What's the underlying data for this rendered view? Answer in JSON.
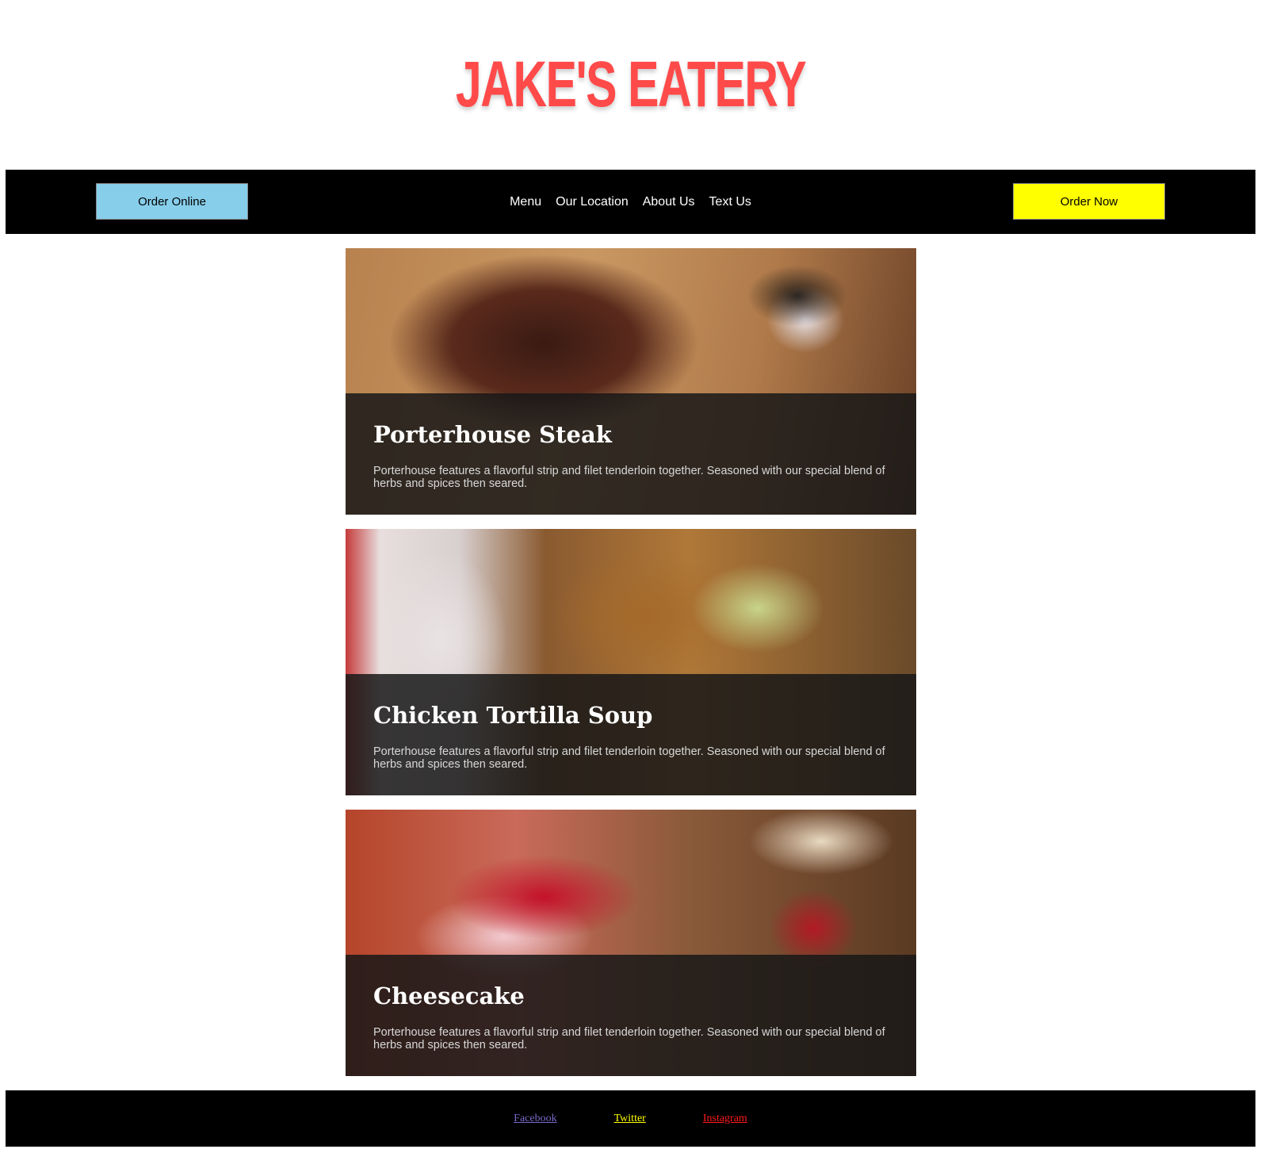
{
  "brand": {
    "logo_text": "Jake's Eatery",
    "logo_color": "#ff4a4a"
  },
  "nav": {
    "order_online_label": "Order Online",
    "order_online_color": "#87ceeb",
    "links": [
      "Menu",
      "Our Location",
      "About Us",
      "Text Us"
    ],
    "order_now_label": "Order Now",
    "order_now_color": "#ffff00"
  },
  "menu_items": [
    {
      "title": "Porterhouse Steak",
      "description": "Porterhouse features a flavorful strip and filet tenderloin together. Seasoned with our special blend of herbs and spices then seared.",
      "image": "steak-photo"
    },
    {
      "title": "Chicken Tortilla Soup",
      "description": "Porterhouse features a flavorful strip and filet tenderloin together. Seasoned with our special blend of herbs and spices then seared.",
      "image": "soup-photo"
    },
    {
      "title": "Cheesecake",
      "description": "Porterhouse features a flavorful strip and filet tenderloin together. Seasoned with our special blend of herbs and spices then seared.",
      "image": "cheesecake-photo"
    }
  ],
  "footer": {
    "links": [
      {
        "label": "Facebook",
        "color": "#7b68c8"
      },
      {
        "label": "Twitter",
        "color": "#ffff00"
      },
      {
        "label": "Instagram",
        "color": "#ff1a1a"
      }
    ]
  }
}
